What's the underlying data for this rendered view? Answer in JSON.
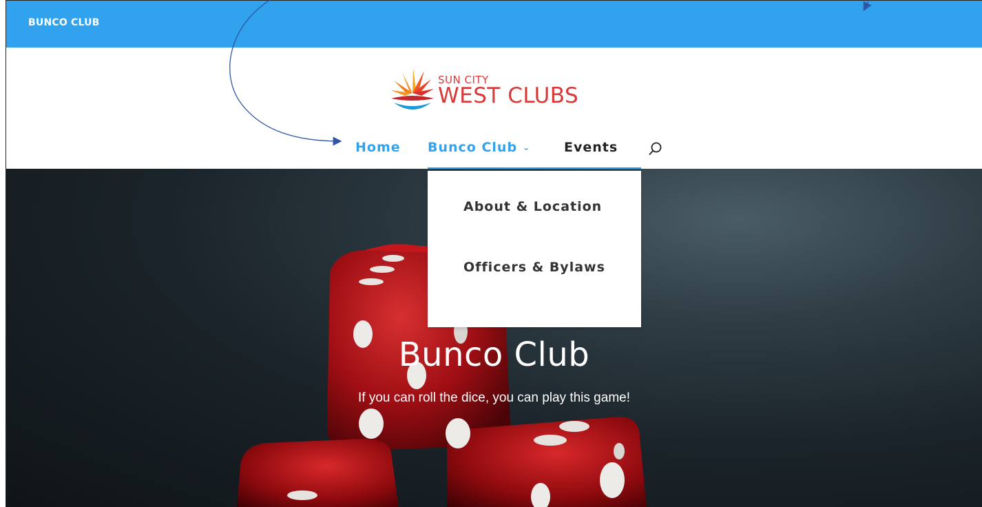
{
  "site": {
    "name": "BUNCO CLUB"
  },
  "logo": {
    "line1": "SUN CITY",
    "line2": "WEST CLUBS"
  },
  "nav": {
    "items": [
      {
        "label": "Home"
      },
      {
        "label": "Bunco Club"
      },
      {
        "label": "Events"
      }
    ],
    "search_icon": "search-icon",
    "dropdown_icon": "chevron-down-icon"
  },
  "dropdown": {
    "items": [
      {
        "label": "About & Location"
      },
      {
        "label": "Officers & Bylaws"
      }
    ]
  },
  "hero": {
    "title": "Bunco Club",
    "subtitle": "If you can roll the dice, you can play this game!"
  },
  "colors": {
    "accent": "#31a3ee",
    "logo_red": "#d93838",
    "annotation": "#2f55a5"
  }
}
